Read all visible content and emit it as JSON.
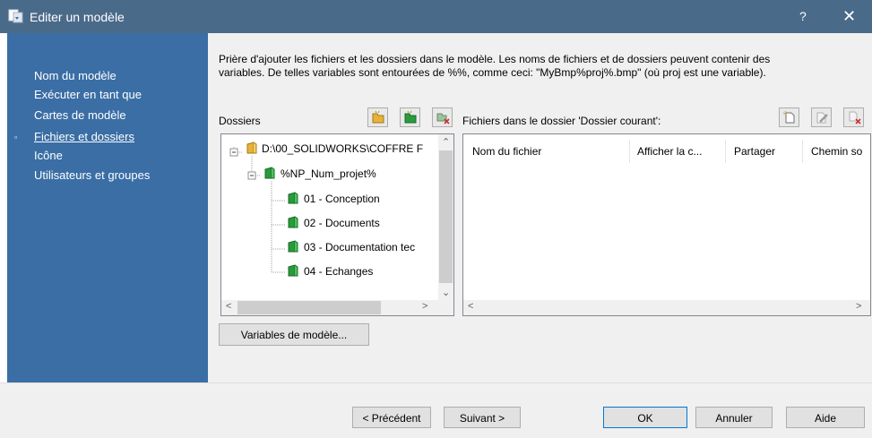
{
  "window": {
    "title": "Editer un modèle",
    "help_label": "?",
    "close_label": "✕"
  },
  "sidebar": {
    "items": [
      {
        "label": "Nom du modèle"
      },
      {
        "label": "Exécuter en tant que"
      },
      {
        "label": "Cartes de modèle"
      },
      {
        "label": "Fichiers et dossiers",
        "selected": true
      },
      {
        "label": "Icône"
      },
      {
        "label": "Utilisateurs et groupes"
      }
    ],
    "bullet": "▫"
  },
  "description": {
    "line1": "Prière d'ajouter les fichiers et les dossiers dans le modèle. Les noms de fichiers et de dossiers peuvent contenir des",
    "line2": "variables. De telles variables sont entourées de %%, comme ceci: \"MyBmp%proj%.bmp\" (où proj est une variable)."
  },
  "folders": {
    "label": "Dossiers",
    "tree": [
      {
        "label": "D:\\00_SOLIDWORKS\\COFFRE F",
        "level": 0
      },
      {
        "label": "%NP_Num_projet%",
        "level": 1
      },
      {
        "label": "01 - Conception",
        "level": 2
      },
      {
        "label": "02 - Documents",
        "level": 2
      },
      {
        "label": "03 - Documentation tec",
        "level": 2
      },
      {
        "label": "04 - Echanges",
        "level": 2
      }
    ]
  },
  "files": {
    "label": "Fichiers dans le dossier 'Dossier courant':",
    "columns": [
      "Nom du fichier",
      "Afficher la c...",
      "Partager",
      "Chemin so"
    ]
  },
  "buttons": {
    "variables": "Variables de modèle...",
    "previous": "< Précédent",
    "next": "Suivant >",
    "ok": "OK",
    "cancel": "Annuler",
    "help": "Aide"
  },
  "colors": {
    "accent": "#3a6ea5",
    "titlebar": "#4a6a8a",
    "folder_yellow": "#e8b23a",
    "folder_green": "#2a9a3a"
  }
}
